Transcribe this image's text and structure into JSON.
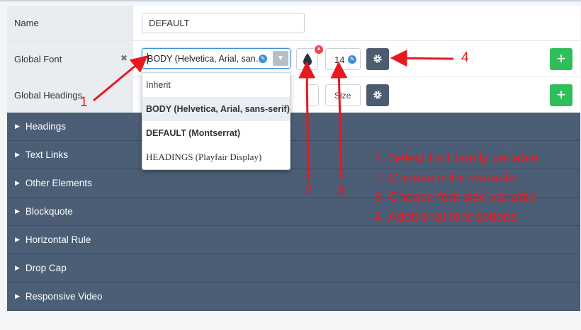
{
  "rows": {
    "name": {
      "label": "Name",
      "value": "DEFAULT"
    },
    "global_font": {
      "label": "Global Font",
      "remove": "✖",
      "selected_font": "BODY (Helvetica, Arial, sans-serif)",
      "size": "14"
    },
    "global_headings": {
      "label": "Global Headings",
      "size_placeholder": "Size"
    }
  },
  "sections": [
    "Headings",
    "Text Links",
    "Other Elements",
    "Blockquote",
    "Horizontal Rule",
    "Drop Cap",
    "Responsive Video"
  ],
  "dropdown": {
    "options": [
      "Inherit",
      "BODY (Helvetica, Arial, sans-serif)",
      "DEFAULT (Montserrat)",
      "HEADINGS (Playfair Display)"
    ]
  },
  "annotations": {
    "markers": [
      "1",
      "2",
      "3",
      "4"
    ],
    "notes": [
      "1. Select font family variable",
      "2. Choose color variable",
      "3. Choose font size variable",
      "4. Additional font options"
    ]
  },
  "icons": {
    "color": "drop-icon",
    "options": "gear-icon",
    "add": "plus-icon",
    "edit": "pencil-icon",
    "clear": "x-icon"
  },
  "colors": {
    "section_bg": "#4b5e76",
    "add_green": "#2fbf5a",
    "annotation_red": "#e8181d",
    "focus_blue": "#3d8fd6"
  }
}
